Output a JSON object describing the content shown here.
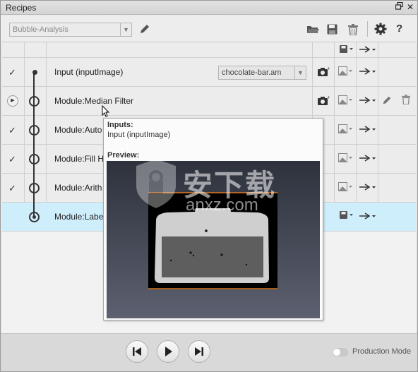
{
  "window": {
    "title": "Recipes"
  },
  "toolbar": {
    "recipe_value": "Bubble-Analysis"
  },
  "rows": [
    {
      "label": "Input (inputImage)",
      "input_value": "chocolate-bar.am"
    },
    {
      "label": "Module:Median Filter"
    },
    {
      "label": "Module:Auto"
    },
    {
      "label": "Module:Fill H"
    },
    {
      "label": "Module:Arith"
    },
    {
      "label": "Module:Labe"
    }
  ],
  "tooltip": {
    "inputs_heading": "Inputs:",
    "inputs_value": "Input (inputImage)",
    "preview_heading": "Preview:"
  },
  "watermark": {
    "text_cn": "安下载",
    "text_en": "anxz.com"
  },
  "bottombar": {
    "production_mode_label": "Production Mode",
    "production_mode_on": false
  },
  "colors": {
    "selected_row": "#cfeefc",
    "accent_line": "#e07a26",
    "panel_bg": "#e9e9e9"
  }
}
